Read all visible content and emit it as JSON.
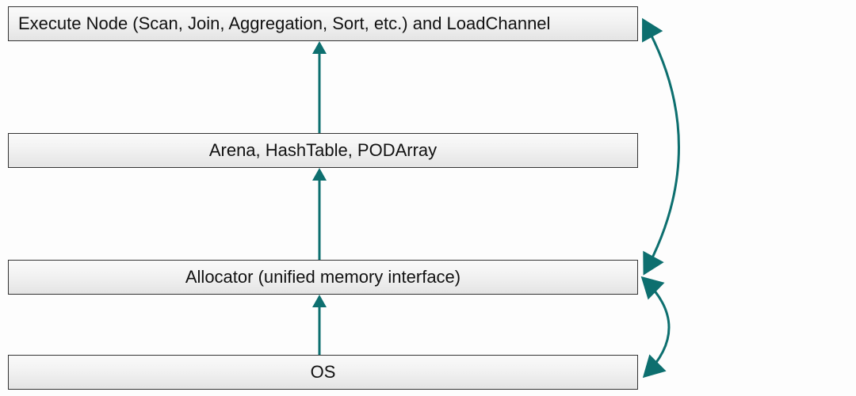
{
  "diagram": {
    "layers": {
      "top": "Execute Node (Scan, Join, Aggregation, Sort, etc.) and LoadChannel",
      "middle": "Arena, HashTable, PODArray",
      "allocator": "Allocator (unified memory interface)",
      "os": "OS"
    },
    "arrow_color": "#0d6f6f"
  }
}
